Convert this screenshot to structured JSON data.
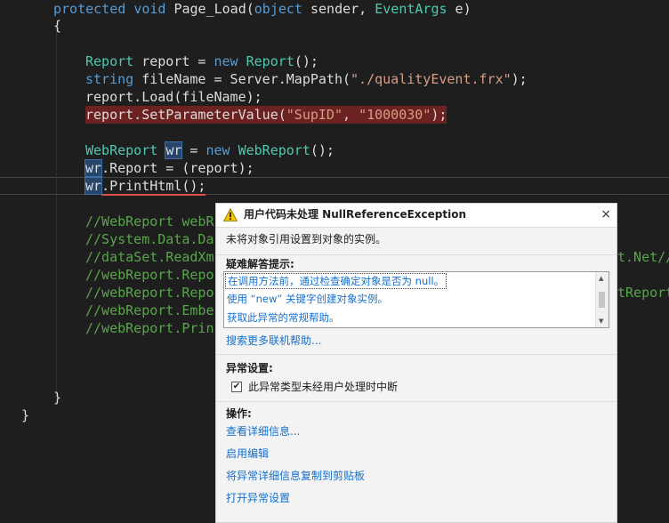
{
  "code": {
    "method_sig": {
      "kw1": "protected",
      "kw2": "void",
      "name": "Page_Load(",
      "kw3": "object",
      "p1": " sender, ",
      "ty1": "EventArgs",
      "p2": " e)"
    },
    "brace_open": "{",
    "l1": {
      "ty": "Report",
      "a": " report = ",
      "kw": "new",
      "b": " ",
      "ty2": "Report",
      "c": "();"
    },
    "l2": {
      "kw": "string",
      "a": " fileName = Server.MapPath(",
      "str": "\"./qualityEvent.frx\"",
      "c": ");"
    },
    "l3": {
      "a": "report.Load(fileName);"
    },
    "l4": {
      "a": "report.SetParameterValue(",
      "s1": "\"SupID\"",
      "b": ", ",
      "s2": "\"1000030\"",
      "c": ");"
    },
    "l5": {
      "ty": "WebReport",
      "a": " ",
      "var": "wr",
      "b": " = ",
      "kw": "new",
      "c": " ",
      "ty2": "WebReport",
      "d": "();"
    },
    "l6": {
      "var": "wr",
      "a": ".Report = (report);"
    },
    "l7": {
      "var": "wr",
      "a": ".PrintHtml();"
    },
    "c1": "//WebReport webR",
    "c2": "//System.Data.Da",
    "c3": "//dataSet.ReadXm",
    "c3b": "t.Net//",
    "c4": "//webReport.Repo",
    "c5": "//webReport.Repo",
    "c5b": "tReport",
    "c6": "//webReport.Embe",
    "c7": "//webReport.Prin",
    "brace_close_inner": "}",
    "brace_close_outer": "}"
  },
  "popup": {
    "title": "用户代码未处理 NullReferenceException",
    "close": "×",
    "message": "未将对象引用设置到对象的实例。",
    "tips_label": "疑难解答提示:",
    "tips": [
      "在调用方法前，通过检查确定对象是否为 null。",
      "使用 “new” 关键字创建对象实例。",
      "获取此异常的常规帮助。"
    ],
    "search_more": "搜索更多联机帮助...",
    "exception_settings_label": "异常设置:",
    "break_checkbox_label": "此异常类型未经用户处理时中断",
    "break_checked": true,
    "actions_label": "操作:",
    "actions": [
      "查看详细信息...",
      "启用编辑",
      "将异常详细信息复制到剪贴板",
      "打开异常设置"
    ]
  }
}
